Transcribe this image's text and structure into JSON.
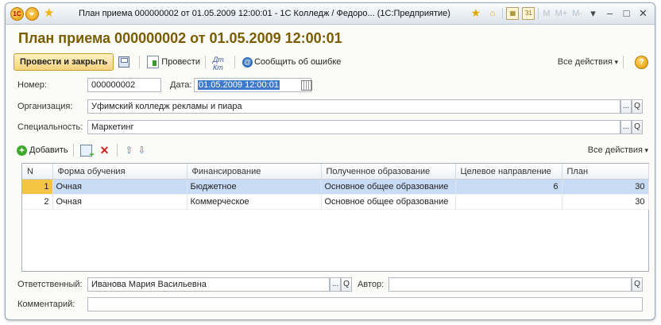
{
  "window": {
    "title": "План приема 000000002 от 01.05.2009 12:00:01 - 1С Колледж / Федоро... (1С:Предприятие)",
    "logo_text": "1С",
    "tb_m": "M",
    "tb_mplus": "M+",
    "tb_mminus": "M-"
  },
  "document": {
    "title": "План приема 000000002 от 01.05.2009 12:00:01"
  },
  "toolbar": {
    "post_close": "Провести и закрыть",
    "post": "Провести",
    "report_error": "Сообщить об ошибке",
    "all_actions": "Все действия"
  },
  "fields": {
    "number_label": "Номер:",
    "number_value": "000000002",
    "date_label": "Дата:",
    "date_value": "01.05.2009 12:00:01",
    "org_label": "Организация:",
    "org_value": "Уфимский колледж рекламы и пиара",
    "spec_label": "Специальность:",
    "spec_value": "Маркетинг",
    "resp_label": "Ответственный:",
    "resp_value": "Иванова Мария Васильевна",
    "author_label": "Автор:",
    "author_value": "",
    "comment_label": "Комментарий:",
    "comment_value": ""
  },
  "table_toolbar": {
    "add": "Добавить",
    "all_actions": "Все действия"
  },
  "table": {
    "columns": [
      "N",
      "Форма обучения",
      "Финансирование",
      "Полученное образование",
      "Целевое направление",
      "План"
    ],
    "rows": [
      {
        "n": "1",
        "form": "Очная",
        "finance": "Бюджетное",
        "education": "Основное общее образование",
        "target": "6",
        "plan": "30"
      },
      {
        "n": "2",
        "form": "Очная",
        "finance": "Коммерческое",
        "education": "Основное общее образование",
        "target": "",
        "plan": "30"
      }
    ]
  },
  "icons": {
    "choose_button": "...",
    "search": "Q"
  }
}
